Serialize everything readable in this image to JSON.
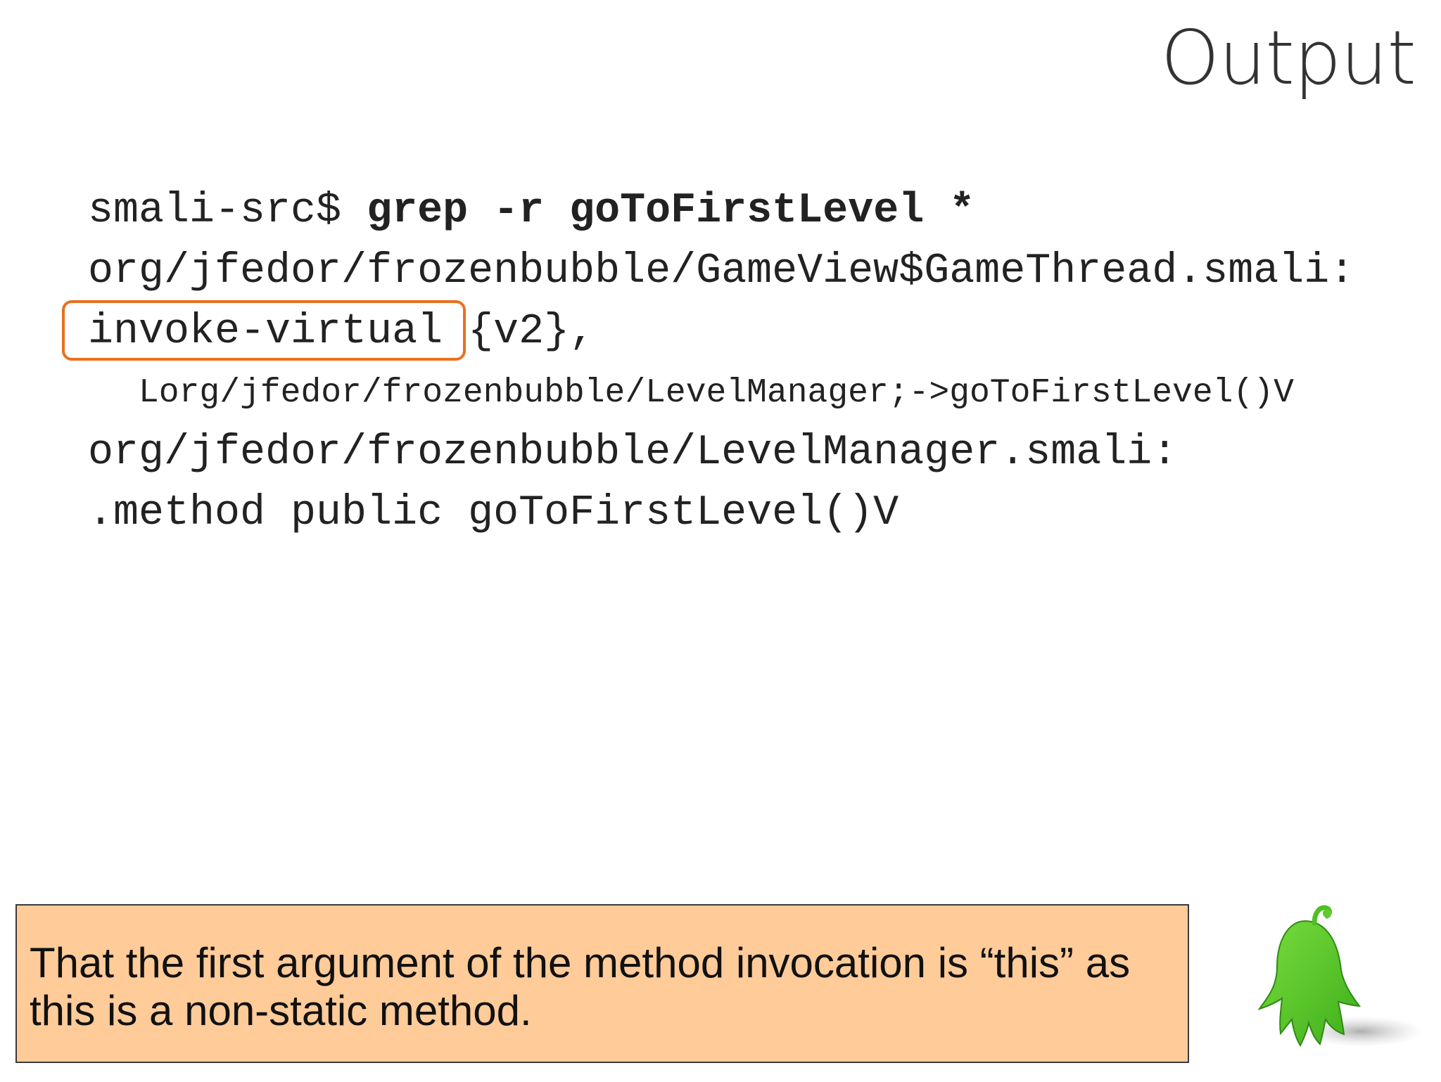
{
  "slide": {
    "title": "Output"
  },
  "code": {
    "prompt": "smali-src$ ",
    "command": "grep -r goToFirstLevel",
    "command_tail": " *",
    "line2": "org/jfedor/frozenbubble/GameView$GameThread.smali:",
    "line3_highlight": "invoke-virtual",
    "line3_rest": " {v2},",
    "line4": "Lorg/jfedor/frozenbubble/LevelManager;->goToFirstLevel()V",
    "line5": "org/jfedor/frozenbubble/LevelManager.smali:",
    "line6": ".method public goToFirstLevel()V"
  },
  "callout": {
    "text_line1": "That the first argument of the method invocation is “this” as",
    "text_line2": "this is a non-static method."
  },
  "colors": {
    "highlight_border": "#E8711F",
    "callout_background": "#FFCB99",
    "mascot_green": "#5ECB2E"
  },
  "icons": {
    "mascot": "green-ghost-mascot-icon"
  }
}
